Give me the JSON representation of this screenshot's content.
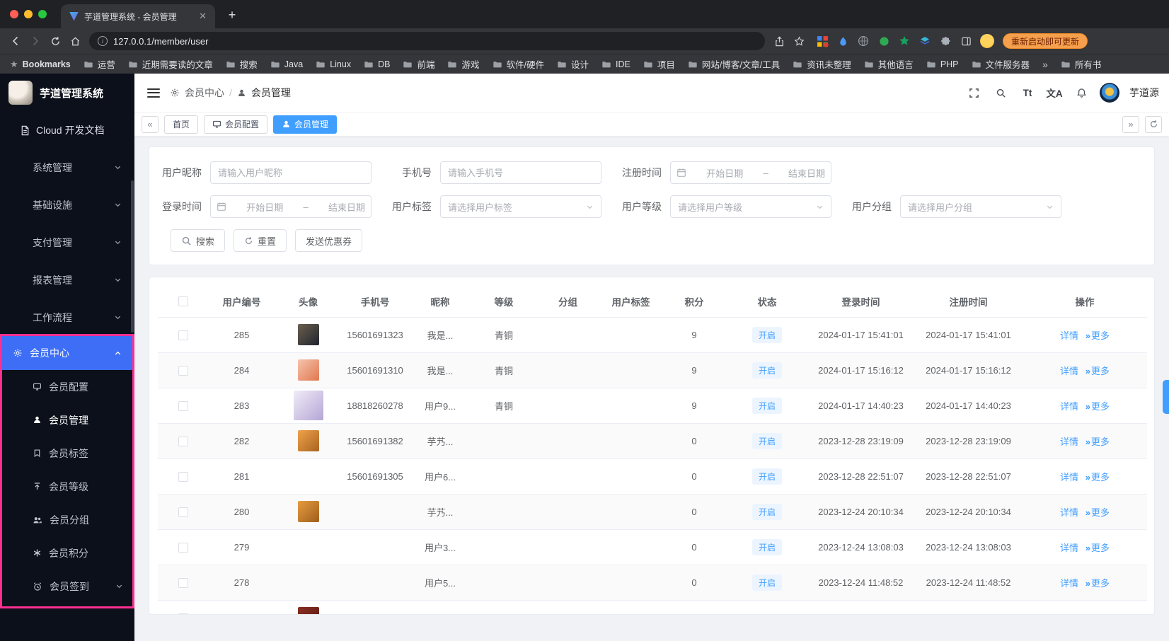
{
  "chrome": {
    "tab_title": "芋道管理系统 - 会员管理",
    "url": "127.0.0.1/member/user",
    "update_button": "重新启动即可更新",
    "bookmarks_label": "Bookmarks",
    "bookmarks": [
      {
        "label": "运营"
      },
      {
        "label": "近期需要读的文章"
      },
      {
        "label": "搜索"
      },
      {
        "label": "Java"
      },
      {
        "label": "Linux"
      },
      {
        "label": "DB"
      },
      {
        "label": "前端"
      },
      {
        "label": "游戏"
      },
      {
        "label": "软件/硬件"
      },
      {
        "label": "设计"
      },
      {
        "label": "IDE"
      },
      {
        "label": "项目"
      },
      {
        "label": "网站/博客/文章/工具"
      },
      {
        "label": "资讯未整理"
      },
      {
        "label": "其他语言"
      },
      {
        "label": "PHP"
      },
      {
        "label": "文件服务器"
      }
    ],
    "bookmarks_overflow_label": "所有书"
  },
  "sidebar": {
    "logo_title": "芋道管理系统",
    "doc_link": "Cloud 开发文档",
    "groups": [
      {
        "label": "系统管理"
      },
      {
        "label": "基础设施"
      },
      {
        "label": "支付管理"
      },
      {
        "label": "报表管理"
      },
      {
        "label": "工作流程"
      }
    ],
    "member_center_label": "会员中心",
    "member_items": [
      {
        "label": "会员配置",
        "icon": "monitor"
      },
      {
        "label": "会员管理",
        "icon": "user",
        "active": true
      },
      {
        "label": "会员标签",
        "icon": "bookmark"
      },
      {
        "label": "会员等级",
        "icon": "upgrade"
      },
      {
        "label": "会员分组",
        "icon": "users"
      },
      {
        "label": "会员积分",
        "icon": "asterisk"
      },
      {
        "label": "会员签到",
        "icon": "clock",
        "has_arrow": true
      }
    ]
  },
  "header": {
    "breadcrumb_root": "会员中心",
    "breadcrumb_sep": "/",
    "breadcrumb_current": "会员管理",
    "font_size_icon_label": "Tt",
    "locale_icon_label": "文A",
    "user_name": "芋道源"
  },
  "tags_bar": {
    "tags": [
      {
        "label": "首页"
      },
      {
        "label": "会员配置",
        "icon": "monitor"
      },
      {
        "label": "会员管理",
        "icon": "user",
        "active": true
      }
    ]
  },
  "filters": {
    "nickname_label": "用户昵称",
    "nickname_placeholder": "请输入用户昵称",
    "mobile_label": "手机号",
    "mobile_placeholder": "请输入手机号",
    "register_time_label": "注册时间",
    "login_time_label": "登录时间",
    "date_start_placeholder": "开始日期",
    "date_separator": "–",
    "date_end_placeholder": "结束日期",
    "tag_label": "用户标签",
    "tag_placeholder": "请选择用户标签",
    "level_label": "用户等级",
    "level_placeholder": "请选择用户等级",
    "group_label": "用户分组",
    "group_placeholder": "请选择用户分组",
    "search_button": "搜索",
    "reset_button": "重置",
    "coupon_button": "发送优惠券"
  },
  "table": {
    "columns": [
      "用户编号",
      "头像",
      "手机号",
      "昵称",
      "等级",
      "分组",
      "用户标签",
      "积分",
      "状态",
      "登录时间",
      "注册时间",
      "操作"
    ],
    "detail_label": "详情",
    "more_label": "更多",
    "rows": [
      {
        "id": "285",
        "phone": "15601691323",
        "nickname": "我是...",
        "level": "青铜",
        "group": "",
        "tags": "",
        "points": "9",
        "status": "开启",
        "login_time": "2024-01-17 15:41:01",
        "register_time": "2024-01-17 15:41:01",
        "avatar": {
          "c1": "#6b5f4e",
          "c2": "#20242f"
        }
      },
      {
        "id": "284",
        "phone": "15601691310",
        "nickname": "我是...",
        "level": "青铜",
        "group": "",
        "tags": "",
        "points": "9",
        "status": "开启",
        "login_time": "2024-01-17 15:16:12",
        "register_time": "2024-01-17 15:16:12",
        "avatar": {
          "c1": "#f6c3ae",
          "c2": "#e0784f"
        }
      },
      {
        "id": "283",
        "phone": "18818260278",
        "nickname": "用户9...",
        "level": "青铜",
        "group": "",
        "tags": "",
        "points": "9",
        "status": "开启",
        "login_time": "2024-01-17 14:40:23",
        "register_time": "2024-01-17 14:40:23",
        "avatar": {
          "c1": "#f1ecf8",
          "c2": "#b5a6d6",
          "large": true
        }
      },
      {
        "id": "282",
        "phone": "15601691382",
        "nickname": "芋艿...",
        "level": "",
        "group": "",
        "tags": "",
        "points": "0",
        "status": "开启",
        "login_time": "2023-12-28 23:19:09",
        "register_time": "2023-12-28 23:19:09",
        "avatar": {
          "c1": "#f0a24a",
          "c2": "#a86420"
        }
      },
      {
        "id": "281",
        "phone": "15601691305",
        "nickname": "用户6...",
        "level": "",
        "group": "",
        "tags": "",
        "points": "0",
        "status": "开启",
        "login_time": "2023-12-28 22:51:07",
        "register_time": "2023-12-28 22:51:07",
        "avatar": null
      },
      {
        "id": "280",
        "phone": "",
        "nickname": "芋艿...",
        "level": "",
        "group": "",
        "tags": "",
        "points": "0",
        "status": "开启",
        "login_time": "2023-12-24 20:10:34",
        "register_time": "2023-12-24 20:10:34",
        "avatar": {
          "c1": "#e89b3f",
          "c2": "#9e5e1c"
        }
      },
      {
        "id": "279",
        "phone": "",
        "nickname": "用户3...",
        "level": "",
        "group": "",
        "tags": "",
        "points": "0",
        "status": "开启",
        "login_time": "2023-12-24 13:08:03",
        "register_time": "2023-12-24 13:08:03",
        "avatar": null
      },
      {
        "id": "278",
        "phone": "",
        "nickname": "用户5...",
        "level": "",
        "group": "",
        "tags": "",
        "points": "0",
        "status": "开启",
        "login_time": "2023-12-24 11:48:52",
        "register_time": "2023-12-24 11:48:52",
        "avatar": null
      },
      {
        "id": "",
        "phone": "",
        "nickname": "",
        "level": "",
        "group": "",
        "tags": "",
        "points": "",
        "status": "",
        "login_time": "",
        "register_time": "",
        "avatar": {
          "c1": "#8a2f23",
          "c2": "#581a12"
        }
      }
    ]
  },
  "colors": {
    "primary": "#409eff",
    "member_parent_active": "#3d6ef5",
    "status_tag_bg": "#ecf5ff",
    "status_tag_border": "#d9ecff",
    "status_tag_text": "#409eff",
    "inspector_highlight": "#ff2f92",
    "sidebar_bg": "#0c101b"
  }
}
